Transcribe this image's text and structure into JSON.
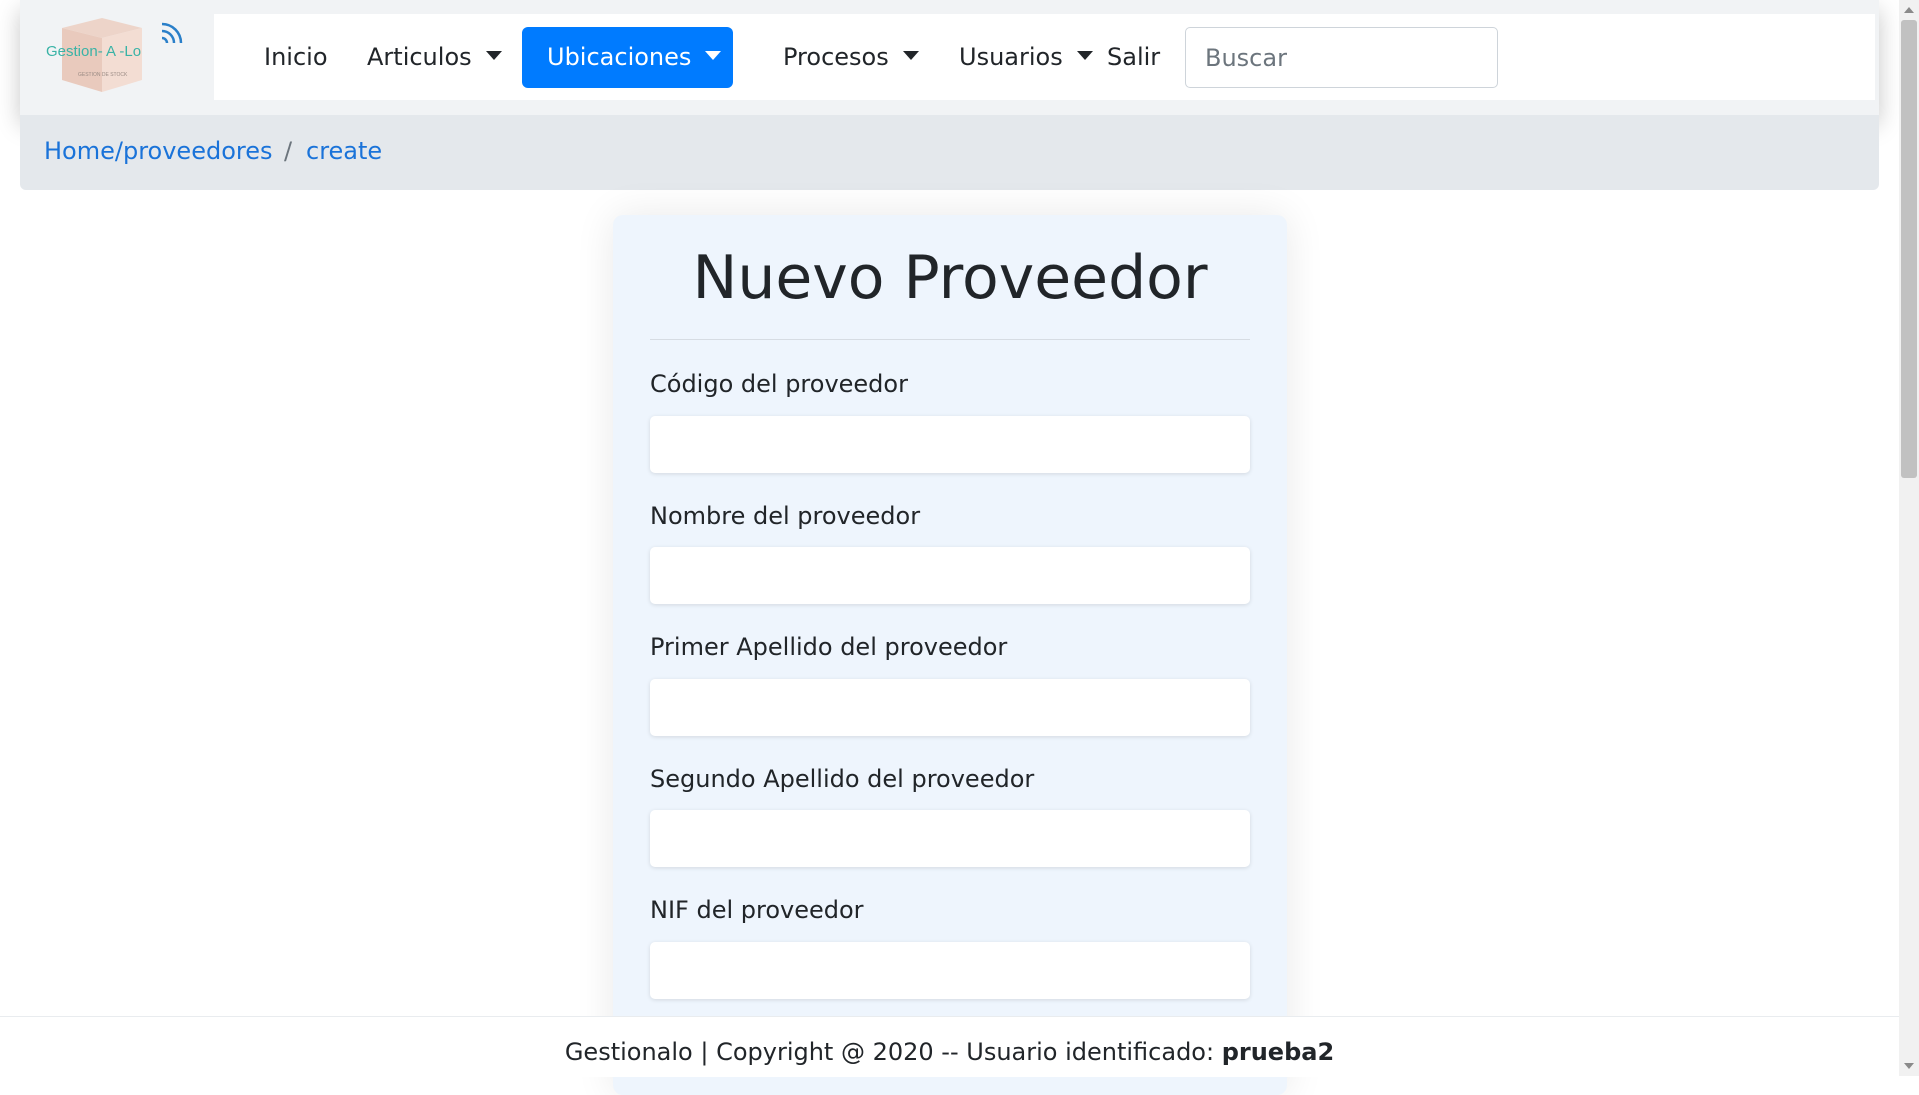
{
  "logo": {
    "text": "Gestion- A -Lo",
    "subtext": "GESTION DE STOCK"
  },
  "nav": {
    "items": [
      {
        "label": "Inicio"
      },
      {
        "label": "Articulos"
      },
      {
        "label": "Ubicaciones"
      },
      {
        "label": "Procesos"
      },
      {
        "label": "Usuarios"
      },
      {
        "label": "Salir"
      }
    ],
    "search_placeholder": "Buscar"
  },
  "breadcrumb": {
    "items": [
      "Home/proveedores",
      "create"
    ],
    "separator": "/"
  },
  "form": {
    "title": "Nuevo Proveedor",
    "fields": [
      {
        "label": "Código del proveedor",
        "value": ""
      },
      {
        "label": "Nombre del proveedor",
        "value": ""
      },
      {
        "label": "Primer Apellido del proveedor",
        "value": ""
      },
      {
        "label": "Segundo Apellido del proveedor",
        "value": ""
      },
      {
        "label": "NIF del proveedor",
        "value": ""
      }
    ]
  },
  "footer": {
    "text": "Gestionalo | Copyright @ 2020 -- Usuario identificado: ",
    "user": "prueba2"
  },
  "colors": {
    "accent": "#007bff",
    "link": "#1a73d9",
    "card_bg": "#eef5fd",
    "breadcrumb_bg": "#e4e8ec"
  },
  "icons": [
    "logo-icon",
    "wifi-icon",
    "caret-down-icon"
  ]
}
